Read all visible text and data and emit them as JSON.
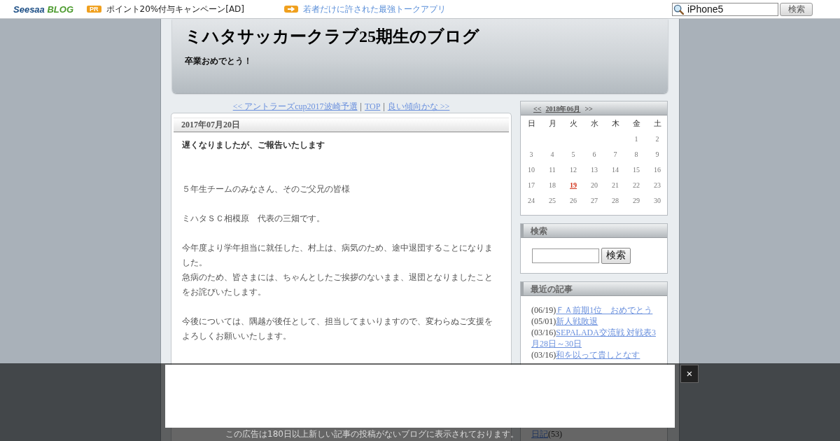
{
  "top_bar": {
    "logo": [
      "Seesaa",
      "BLOG"
    ],
    "pr_badge": "PR",
    "ad_link": "ポイント20%付与キャンペーン[AD]",
    "promo_link": "若者だけに許された最強トークアプリ",
    "search": {
      "value": "iPhone5",
      "button": "検索"
    }
  },
  "header": {
    "title": "ミハタサッカークラブ25期生のブログ",
    "subtitle": "卒業おめでとう！"
  },
  "post_nav": [
    {
      "kind": "link",
      "text": "<< アントラーズcup2017波崎予選"
    },
    {
      "kind": "separator",
      "text": "|"
    },
    {
      "kind": "link",
      "text": "TOP"
    },
    {
      "kind": "separator",
      "text": "|"
    },
    {
      "kind": "link",
      "text": "良い傾向かな >>"
    }
  ],
  "post": {
    "date": "2017年07月20日",
    "paragraphs": [
      {
        "kind": "lead",
        "lines": [
          "遅くなりましたが、ご報告いたします"
        ]
      },
      {
        "kind": "plain",
        "lines": [
          "５年生チームのみなさん、そのご父兄の皆様"
        ]
      },
      {
        "kind": "plain",
        "lines": [
          "ミハタＳＣ相模原　代表の三畑です。"
        ]
      },
      {
        "kind": "plain",
        "lines": [
          "今年度より学年担当に就任した、村上は、病気のため、途中退団することになりました。",
          "急病のため、皆さまには、ちゃんとしたご挨拶のないまま、退団となりましたことをお詫びいたします。"
        ]
      },
      {
        "kind": "plain",
        "lines": [
          "今後については、隅越が後任として、担当してまいりますので、変わらぬご支援をよろしくお願いいたします。"
        ]
      }
    ]
  },
  "sidebar": {
    "calendar": {
      "prev": "<<",
      "month": "2018年06月",
      "next": ">>",
      "weekdays": [
        "日",
        "月",
        "火",
        "水",
        "木",
        "金",
        "土"
      ],
      "weeks": [
        [
          {
            "day": "1",
            "highlighted": false
          },
          {
            "day": "2",
            "highlighted": false
          }
        ],
        [
          {
            "day": "3",
            "highlighted": false
          },
          {
            "day": "4",
            "highlighted": false
          },
          {
            "day": "5",
            "highlighted": false
          },
          {
            "day": "6",
            "highlighted": false
          },
          {
            "day": "7",
            "highlighted": false
          },
          {
            "day": "8",
            "highlighted": false
          },
          {
            "day": "9",
            "highlighted": false
          }
        ],
        [
          {
            "day": "10",
            "highlighted": false
          },
          {
            "day": "11",
            "highlighted": false
          },
          {
            "day": "12",
            "highlighted": false
          },
          {
            "day": "13",
            "highlighted": false
          },
          {
            "day": "14",
            "highlighted": false
          },
          {
            "day": "15",
            "highlighted": false
          },
          {
            "day": "16",
            "highlighted": false
          }
        ],
        [
          {
            "day": "17",
            "highlighted": false
          },
          {
            "day": "18",
            "highlighted": false
          },
          {
            "day": "19",
            "highlighted": true
          },
          {
            "day": "20",
            "highlighted": false
          },
          {
            "day": "21",
            "highlighted": false
          },
          {
            "day": "22",
            "highlighted": false
          },
          {
            "day": "23",
            "highlighted": false
          }
        ],
        [
          {
            "day": "24",
            "highlighted": false
          },
          {
            "day": "25",
            "highlighted": false
          },
          {
            "day": "26",
            "highlighted": false
          },
          {
            "day": "27",
            "highlighted": false
          },
          {
            "day": "28",
            "highlighted": false
          },
          {
            "day": "29",
            "highlighted": false
          },
          {
            "day": "30",
            "highlighted": false
          }
        ]
      ]
    },
    "search": {
      "title": "検索",
      "button": "検索"
    },
    "recent_posts": {
      "title": "最近の記事",
      "items": [
        {
          "date": "(06/19)",
          "title": "ＦＡ前期1位　おめでとう"
        },
        {
          "date": "(05/01)",
          "title": "新人戦敗退"
        },
        {
          "date": "(03/16)",
          "title": "SEPALADA交流戦 対戦表3月28日～30日"
        },
        {
          "date": "(03/16)",
          "title": "和を以って貴しとなす"
        }
      ]
    },
    "categories": {
      "items": [
        {
          "name": "日記",
          "count": "(53)"
        }
      ]
    }
  },
  "ad_overlay": {
    "notice": "この広告は180日以上新しい記事の投稿がないブログに表示されております。",
    "close": "×"
  }
}
